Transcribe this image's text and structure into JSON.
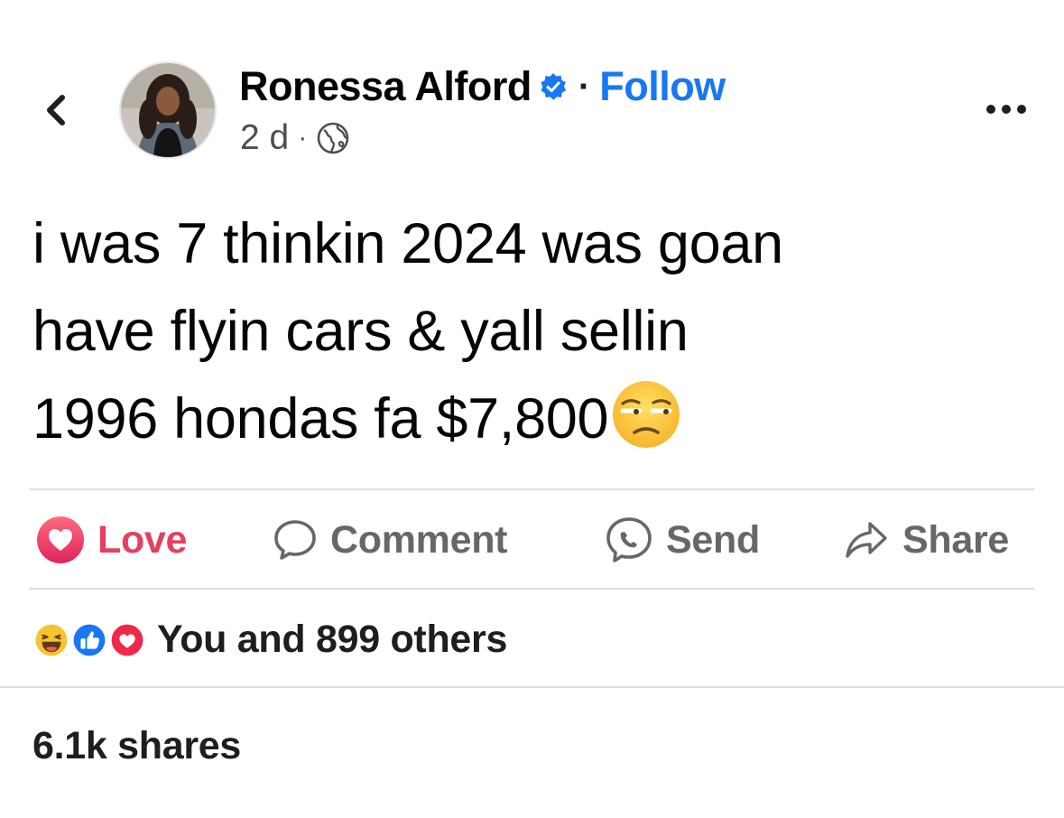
{
  "post": {
    "author_name": "Ronessa Alford",
    "follow_label": "Follow",
    "separator": "·",
    "time": "2 d",
    "meta_separator": "·",
    "audience_icon": "globe-icon",
    "body_lines": [
      "i was 7 thinkin 2024 was goan",
      "have flyin cars & yall sellin",
      "1996 hondas fa $7,800"
    ],
    "trailing_emoji": "unamused-face-emoji"
  },
  "actions": {
    "love_label": "Love",
    "comment_label": "Comment",
    "send_label": "Send",
    "share_label": "Share"
  },
  "reactions": {
    "icons": [
      "haha-reaction-icon",
      "like-reaction-icon",
      "love-reaction-icon"
    ],
    "summary": "You and 899 others"
  },
  "shares": {
    "label": "6.1k shares"
  },
  "colors": {
    "brand_blue": "#1877f2",
    "love_red": "#e4405f",
    "muted_text": "#65676b",
    "divider": "#dadde1"
  }
}
